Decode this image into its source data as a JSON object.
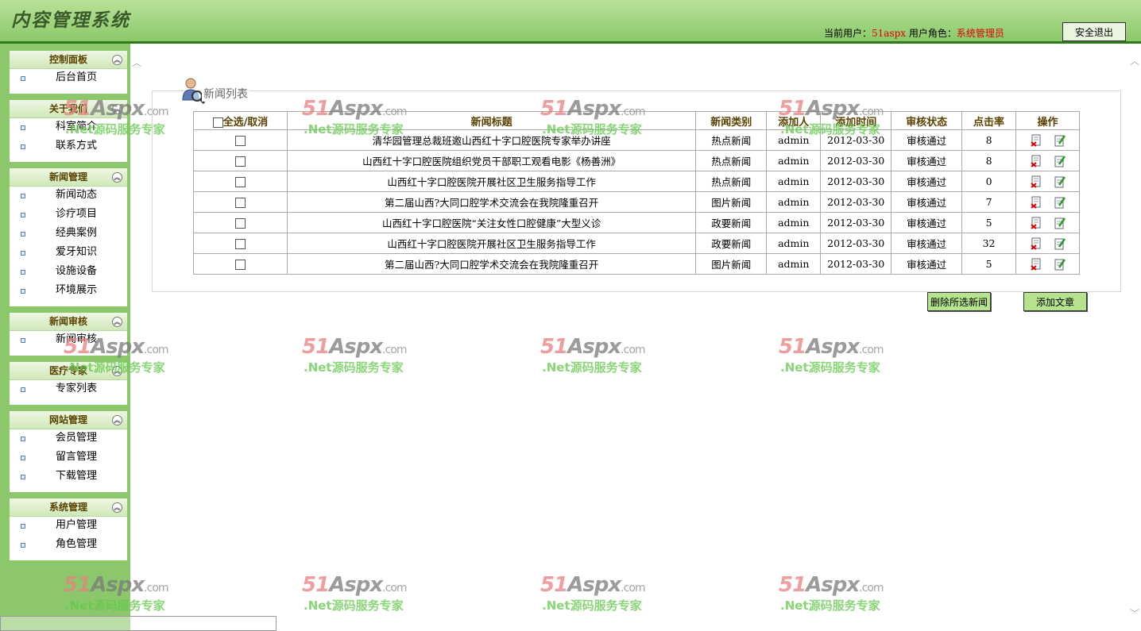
{
  "header": {
    "title": "内容管理系统",
    "current_user_label": "当前用户：",
    "current_user": "51aspx",
    "role_label": "用户角色：",
    "role": "系统管理员",
    "logout": "安全退出"
  },
  "sidebar": {
    "groups": [
      {
        "title": "控制面板",
        "items": [
          "后台首页"
        ]
      },
      {
        "title": "关于我们",
        "items": [
          "科室简介",
          "联系方式"
        ]
      },
      {
        "title": "新闻管理",
        "items": [
          "新闻动态",
          "诊疗项目",
          "经典案例",
          "爱牙知识",
          "设施设备",
          "环境展示"
        ]
      },
      {
        "title": "新闻审核",
        "items": [
          "新闻审核"
        ]
      },
      {
        "title": "医疗专家",
        "items": [
          "专家列表"
        ]
      },
      {
        "title": "网站管理",
        "items": [
          "会员管理",
          "留言管理",
          "下载管理"
        ]
      },
      {
        "title": "系统管理",
        "items": [
          "用户管理",
          "角色管理"
        ]
      }
    ]
  },
  "panel": {
    "title": "新闻列表"
  },
  "table": {
    "headers": [
      "全选/取消",
      "新闻标题",
      "新闻类别",
      "添加人",
      "添加时间",
      "审核状态",
      "点击率",
      "操作"
    ],
    "rows": [
      {
        "title": "清华园管理总裁班邀山西红十字口腔医院专家举办讲座",
        "category": "热点新闻",
        "author": "admin",
        "date": "2012-03-30",
        "status": "审核通过",
        "clicks": "8"
      },
      {
        "title": "山西红十字口腔医院组织党员干部职工观看电影《杨善洲》",
        "category": "热点新闻",
        "author": "admin",
        "date": "2012-03-30",
        "status": "审核通过",
        "clicks": "8"
      },
      {
        "title": "山西红十字口腔医院开展社区卫生服务指导工作",
        "category": "热点新闻",
        "author": "admin",
        "date": "2012-03-30",
        "status": "审核通过",
        "clicks": "0"
      },
      {
        "title": "第二届山西?大同口腔学术交流会在我院隆重召开",
        "category": "图片新闻",
        "author": "admin",
        "date": "2012-03-30",
        "status": "审核通过",
        "clicks": "7"
      },
      {
        "title": "山西红十字口腔医院“关注女性口腔健康”大型义诊",
        "category": "政要新闻",
        "author": "admin",
        "date": "2012-03-30",
        "status": "审核通过",
        "clicks": "5"
      },
      {
        "title": "山西红十字口腔医院开展社区卫生服务指导工作",
        "category": "政要新闻",
        "author": "admin",
        "date": "2012-03-30",
        "status": "审核通过",
        "clicks": "32"
      },
      {
        "title": "第二届山西?大同口腔学术交流会在我院隆重召开",
        "category": "图片新闻",
        "author": "admin",
        "date": "2012-03-30",
        "status": "审核通过",
        "clicks": "5"
      }
    ]
  },
  "actions": {
    "delete_selected": "删除所选新闻",
    "add_article": "添加文章"
  },
  "watermark": {
    "logo_left": "51",
    "logo_mid": "Aspx",
    "logo_com": ".com",
    "tagline": ".Net源码服务专家"
  }
}
